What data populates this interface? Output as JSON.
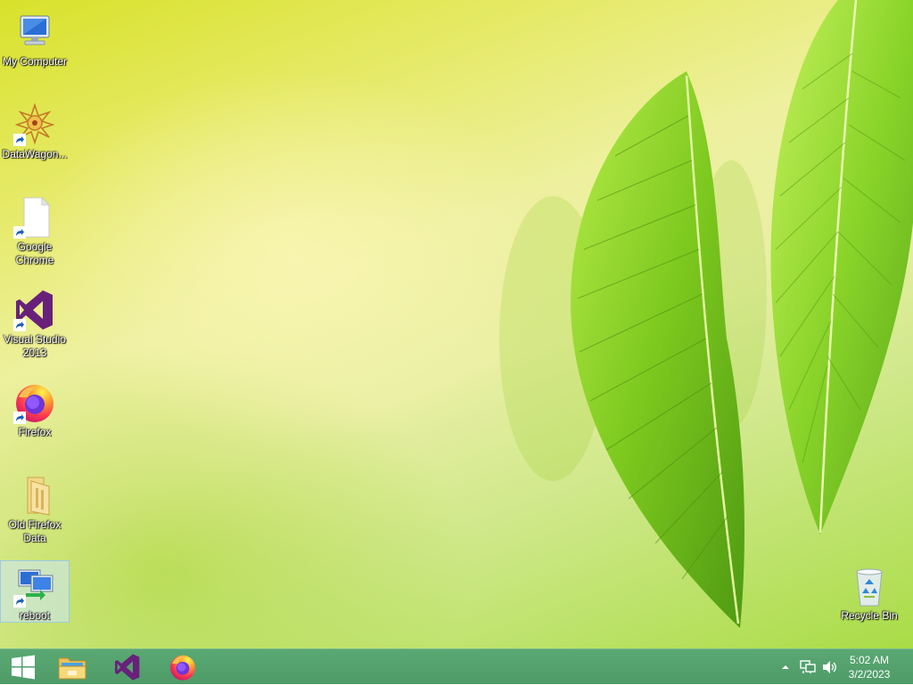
{
  "desktop": {
    "icons": [
      {
        "label": "My Computer",
        "icon": "computer-icon"
      },
      {
        "label": "DataWagon...",
        "icon": "datawagon-icon"
      },
      {
        "label": "Google Chrome",
        "icon": "blank-file-icon"
      },
      {
        "label": "Visual Studio 2013",
        "icon": "visual-studio-icon"
      },
      {
        "label": "Firefox",
        "icon": "firefox-icon"
      },
      {
        "label": "Old Firefox Data",
        "icon": "folder-icon"
      },
      {
        "label": "reboot",
        "icon": "network-computer-icon"
      }
    ],
    "recycle_bin": {
      "label": "Recycle Bin",
      "icon": "recycle-bin-icon"
    }
  },
  "taskbar": {
    "pinned": [
      {
        "name": "start",
        "icon": "windows-logo-icon"
      },
      {
        "name": "file-explorer",
        "icon": "file-explorer-icon"
      },
      {
        "name": "visual-studio",
        "icon": "visual-studio-icon"
      },
      {
        "name": "firefox",
        "icon": "firefox-icon"
      }
    ],
    "tray": {
      "icons": [
        "show-hidden-icons-chevron",
        "network-icon",
        "volume-icon"
      ],
      "time": "5:02 AM",
      "date": "3/2/2023"
    }
  },
  "colors": {
    "taskbar": "#4e9b68",
    "selection": "#cde8ff",
    "vs_purple": "#68217a"
  }
}
